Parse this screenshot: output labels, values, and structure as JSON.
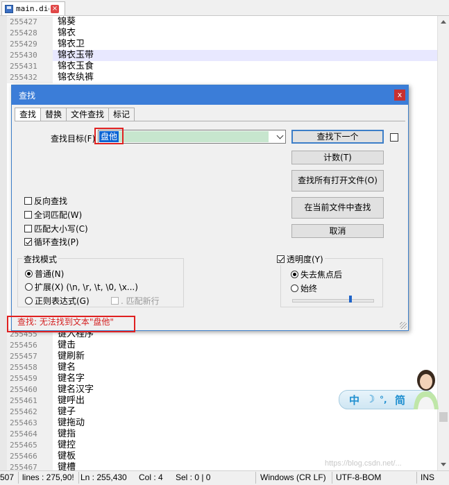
{
  "editor_tab": {
    "filename": "main.dic",
    "close_glyph": "×"
  },
  "lines_top": [
    {
      "num": "255427",
      "text": "锦葵"
    },
    {
      "num": "255428",
      "text": "锦衣"
    },
    {
      "num": "255429",
      "text": "锦衣卫"
    },
    {
      "num": "255430",
      "text": "锦衣玉带"
    },
    {
      "num": "255431",
      "text": "锦衣玉食"
    },
    {
      "num": "255432",
      "text": "锦衣纨裤"
    }
  ],
  "lines_bottom": [
    {
      "num": "255455",
      "text": "键入程序"
    },
    {
      "num": "255456",
      "text": "键击"
    },
    {
      "num": "255457",
      "text": "键刷新"
    },
    {
      "num": "255458",
      "text": "键名"
    },
    {
      "num": "255459",
      "text": "键名字"
    },
    {
      "num": "255460",
      "text": "键名汉字"
    },
    {
      "num": "255461",
      "text": "键呼出"
    },
    {
      "num": "255462",
      "text": "键子"
    },
    {
      "num": "255463",
      "text": "键拖动"
    },
    {
      "num": "255464",
      "text": "键指"
    },
    {
      "num": "255465",
      "text": "键控"
    },
    {
      "num": "255466",
      "text": "键板"
    },
    {
      "num": "255467",
      "text": "键槽"
    }
  ],
  "dialog": {
    "title": "查找",
    "close": "x",
    "tabs": [
      "查找",
      "替换",
      "文件查找",
      "标记"
    ],
    "find_label": "查找目标(F) :",
    "find_value": "盘他",
    "buttons": {
      "find_next": "查找下一个",
      "count": "计数(T)",
      "find_all_open": "查找所有打开文件(O)",
      "find_in_current": "在当前文件中查找",
      "cancel": "取消"
    },
    "options": {
      "backward": "反向查找",
      "whole_word": "全词匹配(W)",
      "match_case": "匹配大小写(C)",
      "wrap": "循环查找(P)"
    },
    "search_mode": {
      "title": "查找模式",
      "normal": "普通(N)",
      "extended": "扩展(X) (\\n, \\r, \\t, \\0, \\x...)",
      "regex": "正则表达式(G)",
      "dot_newline": ". 匹配新行"
    },
    "transparency": {
      "title": "透明度(Y)",
      "on_lose_focus": "失去焦点后",
      "always": "始终",
      "level_fraction": 0.72
    },
    "status": "查找: 无法找到文本\"盘他\""
  },
  "statusbar": {
    "partial": "507",
    "lines": "lines : 275,90!",
    "ln": "Ln : 255,430",
    "col": "Col : 4",
    "sel": "Sel : 0 | 0",
    "eol": "Windows (CR LF)",
    "encoding": "UTF-8-BOM",
    "mode": "INS"
  },
  "ime": {
    "lang": "中",
    "moon": "☽",
    "punct": "°,",
    "script": "简"
  },
  "watermark": "https://blog.csdn.net/...",
  "colors": {
    "accent": "#3b7dd8",
    "error": "#d42020",
    "current_line": "#e8e8ff",
    "highlight": "#c7e6ce"
  }
}
